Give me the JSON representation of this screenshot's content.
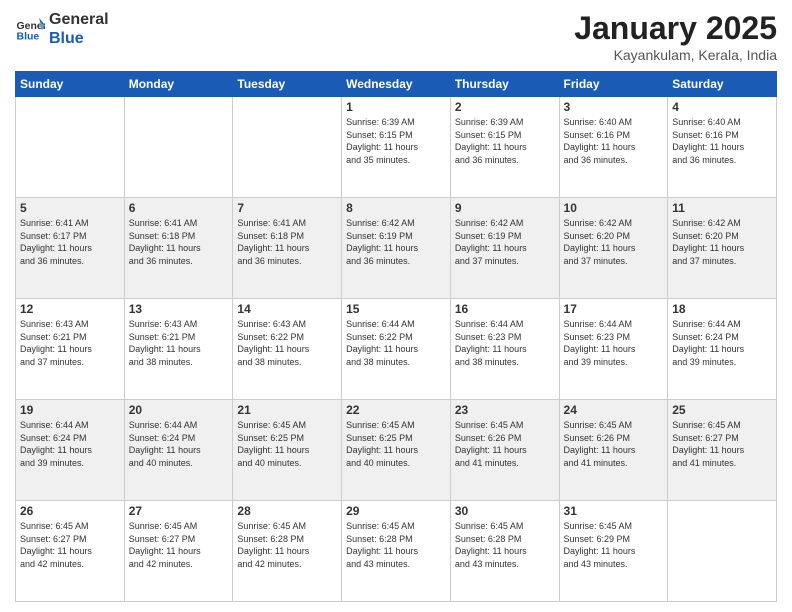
{
  "header": {
    "logo_general": "General",
    "logo_blue": "Blue",
    "month_year": "January 2025",
    "location": "Kayankulam, Kerala, India"
  },
  "weekdays": [
    "Sunday",
    "Monday",
    "Tuesday",
    "Wednesday",
    "Thursday",
    "Friday",
    "Saturday"
  ],
  "weeks": [
    [
      {
        "day": "",
        "info": ""
      },
      {
        "day": "",
        "info": ""
      },
      {
        "day": "",
        "info": ""
      },
      {
        "day": "1",
        "info": "Sunrise: 6:39 AM\nSunset: 6:15 PM\nDaylight: 11 hours\nand 35 minutes."
      },
      {
        "day": "2",
        "info": "Sunrise: 6:39 AM\nSunset: 6:15 PM\nDaylight: 11 hours\nand 36 minutes."
      },
      {
        "day": "3",
        "info": "Sunrise: 6:40 AM\nSunset: 6:16 PM\nDaylight: 11 hours\nand 36 minutes."
      },
      {
        "day": "4",
        "info": "Sunrise: 6:40 AM\nSunset: 6:16 PM\nDaylight: 11 hours\nand 36 minutes."
      }
    ],
    [
      {
        "day": "5",
        "info": "Sunrise: 6:41 AM\nSunset: 6:17 PM\nDaylight: 11 hours\nand 36 minutes."
      },
      {
        "day": "6",
        "info": "Sunrise: 6:41 AM\nSunset: 6:18 PM\nDaylight: 11 hours\nand 36 minutes."
      },
      {
        "day": "7",
        "info": "Sunrise: 6:41 AM\nSunset: 6:18 PM\nDaylight: 11 hours\nand 36 minutes."
      },
      {
        "day": "8",
        "info": "Sunrise: 6:42 AM\nSunset: 6:19 PM\nDaylight: 11 hours\nand 36 minutes."
      },
      {
        "day": "9",
        "info": "Sunrise: 6:42 AM\nSunset: 6:19 PM\nDaylight: 11 hours\nand 37 minutes."
      },
      {
        "day": "10",
        "info": "Sunrise: 6:42 AM\nSunset: 6:20 PM\nDaylight: 11 hours\nand 37 minutes."
      },
      {
        "day": "11",
        "info": "Sunrise: 6:42 AM\nSunset: 6:20 PM\nDaylight: 11 hours\nand 37 minutes."
      }
    ],
    [
      {
        "day": "12",
        "info": "Sunrise: 6:43 AM\nSunset: 6:21 PM\nDaylight: 11 hours\nand 37 minutes."
      },
      {
        "day": "13",
        "info": "Sunrise: 6:43 AM\nSunset: 6:21 PM\nDaylight: 11 hours\nand 38 minutes."
      },
      {
        "day": "14",
        "info": "Sunrise: 6:43 AM\nSunset: 6:22 PM\nDaylight: 11 hours\nand 38 minutes."
      },
      {
        "day": "15",
        "info": "Sunrise: 6:44 AM\nSunset: 6:22 PM\nDaylight: 11 hours\nand 38 minutes."
      },
      {
        "day": "16",
        "info": "Sunrise: 6:44 AM\nSunset: 6:23 PM\nDaylight: 11 hours\nand 38 minutes."
      },
      {
        "day": "17",
        "info": "Sunrise: 6:44 AM\nSunset: 6:23 PM\nDaylight: 11 hours\nand 39 minutes."
      },
      {
        "day": "18",
        "info": "Sunrise: 6:44 AM\nSunset: 6:24 PM\nDaylight: 11 hours\nand 39 minutes."
      }
    ],
    [
      {
        "day": "19",
        "info": "Sunrise: 6:44 AM\nSunset: 6:24 PM\nDaylight: 11 hours\nand 39 minutes."
      },
      {
        "day": "20",
        "info": "Sunrise: 6:44 AM\nSunset: 6:24 PM\nDaylight: 11 hours\nand 40 minutes."
      },
      {
        "day": "21",
        "info": "Sunrise: 6:45 AM\nSunset: 6:25 PM\nDaylight: 11 hours\nand 40 minutes."
      },
      {
        "day": "22",
        "info": "Sunrise: 6:45 AM\nSunset: 6:25 PM\nDaylight: 11 hours\nand 40 minutes."
      },
      {
        "day": "23",
        "info": "Sunrise: 6:45 AM\nSunset: 6:26 PM\nDaylight: 11 hours\nand 41 minutes."
      },
      {
        "day": "24",
        "info": "Sunrise: 6:45 AM\nSunset: 6:26 PM\nDaylight: 11 hours\nand 41 minutes."
      },
      {
        "day": "25",
        "info": "Sunrise: 6:45 AM\nSunset: 6:27 PM\nDaylight: 11 hours\nand 41 minutes."
      }
    ],
    [
      {
        "day": "26",
        "info": "Sunrise: 6:45 AM\nSunset: 6:27 PM\nDaylight: 11 hours\nand 42 minutes."
      },
      {
        "day": "27",
        "info": "Sunrise: 6:45 AM\nSunset: 6:27 PM\nDaylight: 11 hours\nand 42 minutes."
      },
      {
        "day": "28",
        "info": "Sunrise: 6:45 AM\nSunset: 6:28 PM\nDaylight: 11 hours\nand 42 minutes."
      },
      {
        "day": "29",
        "info": "Sunrise: 6:45 AM\nSunset: 6:28 PM\nDaylight: 11 hours\nand 43 minutes."
      },
      {
        "day": "30",
        "info": "Sunrise: 6:45 AM\nSunset: 6:28 PM\nDaylight: 11 hours\nand 43 minutes."
      },
      {
        "day": "31",
        "info": "Sunrise: 6:45 AM\nSunset: 6:29 PM\nDaylight: 11 hours\nand 43 minutes."
      },
      {
        "day": "",
        "info": ""
      }
    ]
  ]
}
